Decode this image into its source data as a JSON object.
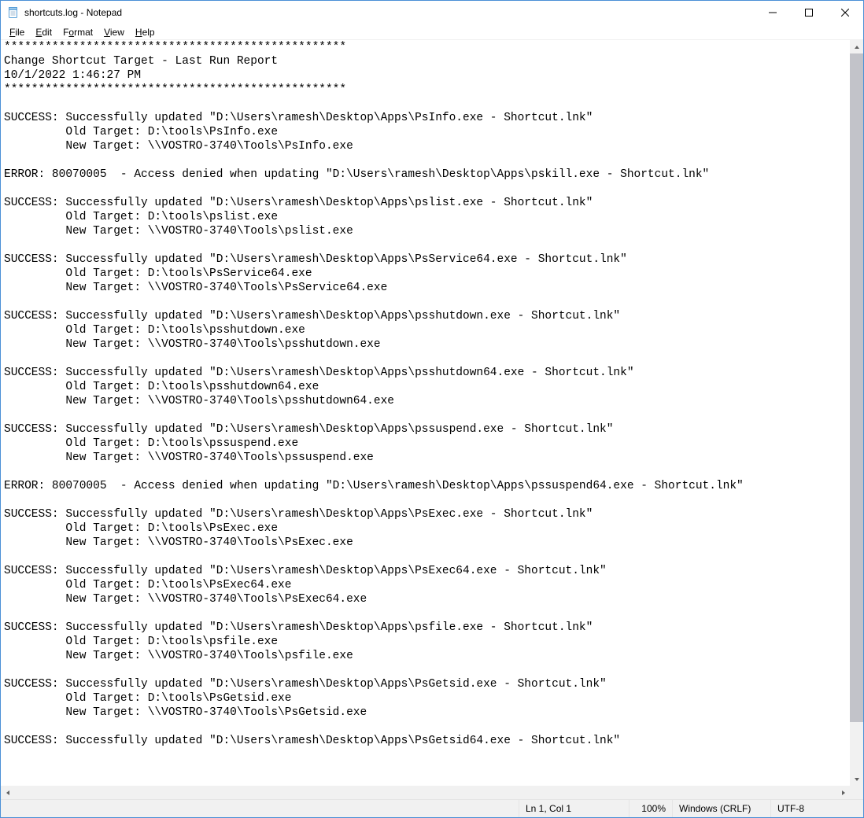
{
  "window": {
    "title": "shortcuts.log - Notepad"
  },
  "menu": {
    "file": {
      "u": "F",
      "rest": "ile"
    },
    "edit": {
      "u": "E",
      "rest": "dit"
    },
    "format": {
      "pre": "F",
      "u": "o",
      "rest": "rmat"
    },
    "view": {
      "u": "V",
      "rest": "iew"
    },
    "help": {
      "u": "H",
      "rest": "elp"
    }
  },
  "content": "**************************************************\nChange Shortcut Target - Last Run Report\n10/1/2022 1:46:27 PM\n**************************************************\n\nSUCCESS: Successfully updated \"D:\\Users\\ramesh\\Desktop\\Apps\\PsInfo.exe - Shortcut.lnk\"\n         Old Target: D:\\tools\\PsInfo.exe\n         New Target: \\\\VOSTRO-3740\\Tools\\PsInfo.exe\n\nERROR: 80070005  - Access denied when updating \"D:\\Users\\ramesh\\Desktop\\Apps\\pskill.exe - Shortcut.lnk\"\n\nSUCCESS: Successfully updated \"D:\\Users\\ramesh\\Desktop\\Apps\\pslist.exe - Shortcut.lnk\"\n         Old Target: D:\\tools\\pslist.exe\n         New Target: \\\\VOSTRO-3740\\Tools\\pslist.exe\n\nSUCCESS: Successfully updated \"D:\\Users\\ramesh\\Desktop\\Apps\\PsService64.exe - Shortcut.lnk\"\n         Old Target: D:\\tools\\PsService64.exe\n         New Target: \\\\VOSTRO-3740\\Tools\\PsService64.exe\n\nSUCCESS: Successfully updated \"D:\\Users\\ramesh\\Desktop\\Apps\\psshutdown.exe - Shortcut.lnk\"\n         Old Target: D:\\tools\\psshutdown.exe\n         New Target: \\\\VOSTRO-3740\\Tools\\psshutdown.exe\n\nSUCCESS: Successfully updated \"D:\\Users\\ramesh\\Desktop\\Apps\\psshutdown64.exe - Shortcut.lnk\"\n         Old Target: D:\\tools\\psshutdown64.exe\n         New Target: \\\\VOSTRO-3740\\Tools\\psshutdown64.exe\n\nSUCCESS: Successfully updated \"D:\\Users\\ramesh\\Desktop\\Apps\\pssuspend.exe - Shortcut.lnk\"\n         Old Target: D:\\tools\\pssuspend.exe\n         New Target: \\\\VOSTRO-3740\\Tools\\pssuspend.exe\n\nERROR: 80070005  - Access denied when updating \"D:\\Users\\ramesh\\Desktop\\Apps\\pssuspend64.exe - Shortcut.lnk\"\n\nSUCCESS: Successfully updated \"D:\\Users\\ramesh\\Desktop\\Apps\\PsExec.exe - Shortcut.lnk\"\n         Old Target: D:\\tools\\PsExec.exe\n         New Target: \\\\VOSTRO-3740\\Tools\\PsExec.exe\n\nSUCCESS: Successfully updated \"D:\\Users\\ramesh\\Desktop\\Apps\\PsExec64.exe - Shortcut.lnk\"\n         Old Target: D:\\tools\\PsExec64.exe\n         New Target: \\\\VOSTRO-3740\\Tools\\PsExec64.exe\n\nSUCCESS: Successfully updated \"D:\\Users\\ramesh\\Desktop\\Apps\\psfile.exe - Shortcut.lnk\"\n         Old Target: D:\\tools\\psfile.exe\n         New Target: \\\\VOSTRO-3740\\Tools\\psfile.exe\n\nSUCCESS: Successfully updated \"D:\\Users\\ramesh\\Desktop\\Apps\\PsGetsid.exe - Shortcut.lnk\"\n         Old Target: D:\\tools\\PsGetsid.exe\n         New Target: \\\\VOSTRO-3740\\Tools\\PsGetsid.exe\n\nSUCCESS: Successfully updated \"D:\\Users\\ramesh\\Desktop\\Apps\\PsGetsid64.exe - Shortcut.lnk\"",
  "status": {
    "position": "Ln 1, Col 1",
    "zoom": "100%",
    "eol": "Windows (CRLF)",
    "encoding": "UTF-8"
  }
}
